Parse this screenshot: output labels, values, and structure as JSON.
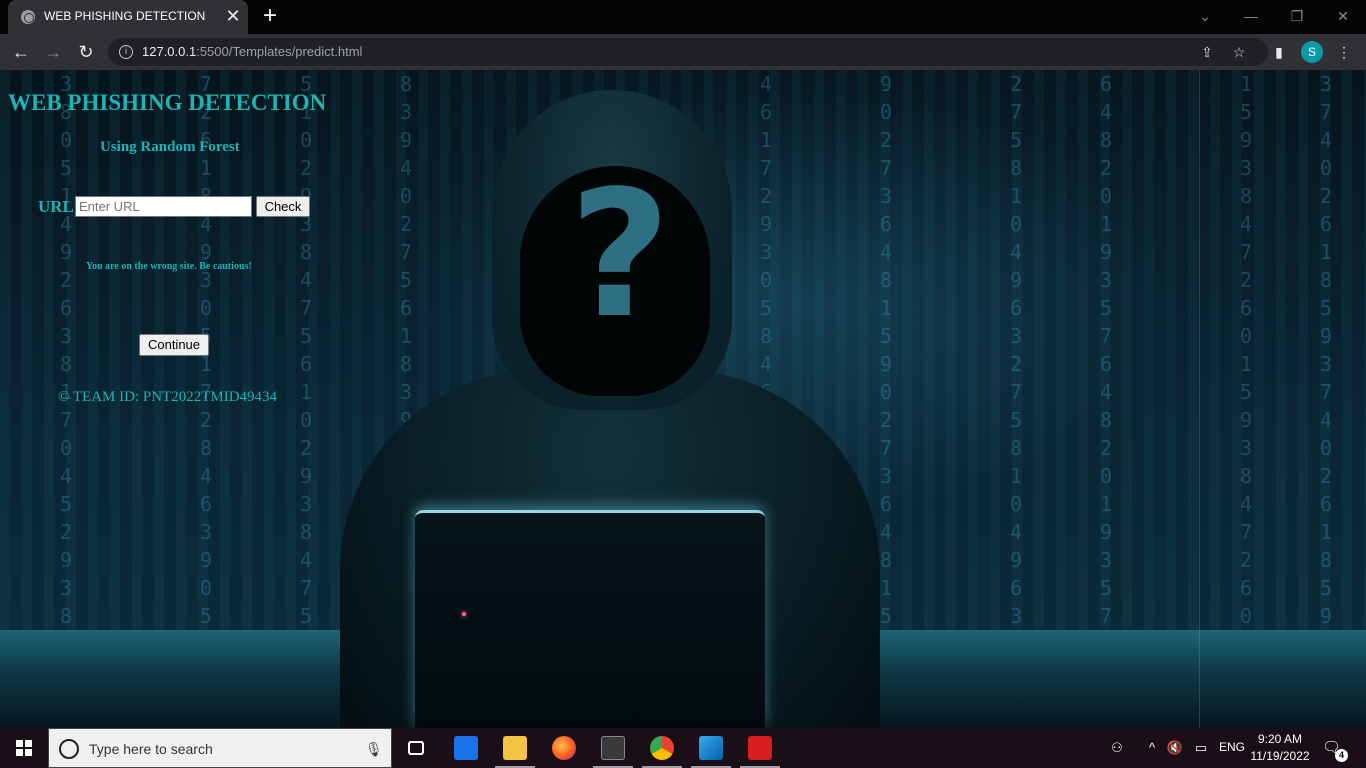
{
  "browser": {
    "tab_title": "WEB PHISHING DETECTION",
    "tab_close": "✕",
    "new_tab": "+",
    "url_host": "127.0.0.1",
    "url_rest": ":5500/Templates/predict.html",
    "profile_initial": "S"
  },
  "page": {
    "title": "WEB PHISHING DETECTION",
    "subtitle": "Using Random Forest",
    "url_label": "URL",
    "url_placeholder": "Enter URL",
    "check_label": "Check",
    "result_message": "You are on the wrong site. Be cautious!",
    "continue_label": "Continue",
    "team_text": "© TEAM ID: PNT2022TMID49434",
    "accent_color": "#1fb3b3"
  },
  "taskbar": {
    "search_placeholder": "Type here to search",
    "language": "ENG",
    "time": "9:20 AM",
    "date": "11/19/2022",
    "notification_count": "4"
  }
}
